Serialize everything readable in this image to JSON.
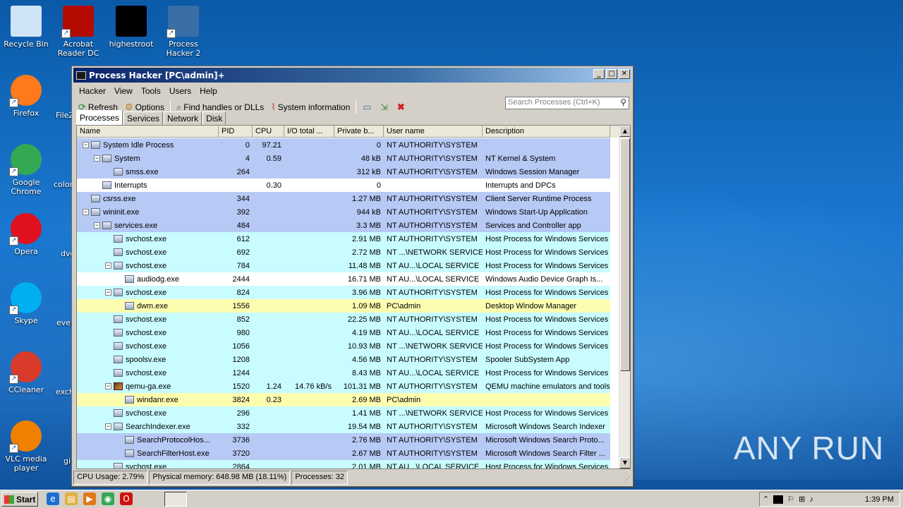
{
  "desktop": {
    "icons": [
      {
        "id": "recycle",
        "label": "Recycle Bin",
        "icon": "recycle-bin-icon",
        "color": "#cfe4f7"
      },
      {
        "id": "acrobat",
        "label": "Acrobat Reader DC",
        "icon": "acrobat-icon",
        "color": "#b30b00"
      },
      {
        "id": "highestroot",
        "label": "highestroot",
        "icon": "black-file-icon",
        "color": "#000000"
      },
      {
        "id": "processhacker",
        "label": "Process Hacker 2",
        "icon": "process-hacker-icon",
        "color": "#3a6ea5"
      },
      {
        "id": "firefox",
        "label": "Firefox",
        "icon": "firefox-icon",
        "color": "#ff7a1a"
      },
      {
        "id": "chrome",
        "label": "Google Chrome",
        "icon": "chrome-icon",
        "color": "#34a853"
      },
      {
        "id": "opera",
        "label": "Opera",
        "icon": "opera-icon",
        "color": "#e0101e"
      },
      {
        "id": "skype",
        "label": "Skype",
        "icon": "skype-icon",
        "color": "#00aff0"
      },
      {
        "id": "ccleaner",
        "label": "CCleaner",
        "icon": "ccleaner-icon",
        "color": "#d93b2b"
      },
      {
        "id": "vlc",
        "label": "VLC media player",
        "icon": "vlc-icon",
        "color": "#f08000"
      }
    ],
    "partial_labels": [
      "FileZ",
      "color",
      "dvd",
      "ever",
      "exch",
      "gi"
    ],
    "watermark": "ANY RUN"
  },
  "window": {
    "title": "Process Hacker [PC\\admin]+",
    "menu": [
      "Hacker",
      "View",
      "Tools",
      "Users",
      "Help"
    ],
    "toolbar": {
      "refresh": "Refresh",
      "options": "Options",
      "find_handles": "Find handles or DLLs",
      "system_info": "System information"
    },
    "search_placeholder": "Search Processes (Ctrl+K)",
    "tabs": [
      "Processes",
      "Services",
      "Network",
      "Disk"
    ],
    "columns": [
      "Name",
      "PID",
      "CPU",
      "I/O total ...",
      "Private b...",
      "User name",
      "Description"
    ],
    "rows": [
      {
        "name": "System Idle Process",
        "depth": 0,
        "toggle": "−",
        "pid": "0",
        "cpu": "97.21",
        "io": "",
        "priv": "0",
        "user": "NT AUTHORITY\\SYSTEM",
        "desc": "",
        "bg": "#b7c9f5"
      },
      {
        "name": "System",
        "depth": 1,
        "toggle": "−",
        "pid": "4",
        "cpu": "0.59",
        "io": "",
        "priv": "48 kB",
        "user": "NT AUTHORITY\\SYSTEM",
        "desc": "NT Kernel & System",
        "bg": "#b7c9f5"
      },
      {
        "name": "smss.exe",
        "depth": 2,
        "toggle": "",
        "pid": "264",
        "cpu": "",
        "io": "",
        "priv": "312 kB",
        "user": "NT AUTHORITY\\SYSTEM",
        "desc": "Windows Session Manager",
        "bg": "#b7c9f5"
      },
      {
        "name": "Interrupts",
        "depth": 1,
        "toggle": "",
        "pid": "",
        "cpu": "0.30",
        "io": "",
        "priv": "0",
        "user": "",
        "desc": "Interrupts and DPCs",
        "bg": "#ffffff"
      },
      {
        "name": "csrss.exe",
        "depth": 0,
        "toggle": "",
        "pid": "344",
        "cpu": "",
        "io": "",
        "priv": "1.27 MB",
        "user": "NT AUTHORITY\\SYSTEM",
        "desc": "Client Server Runtime Process",
        "bg": "#b7c9f5"
      },
      {
        "name": "wininit.exe",
        "depth": 0,
        "toggle": "−",
        "pid": "392",
        "cpu": "",
        "io": "",
        "priv": "944 kB",
        "user": "NT AUTHORITY\\SYSTEM",
        "desc": "Windows Start-Up Application",
        "bg": "#b7c9f5"
      },
      {
        "name": "services.exe",
        "depth": 1,
        "toggle": "−",
        "pid": "484",
        "cpu": "",
        "io": "",
        "priv": "3.3 MB",
        "user": "NT AUTHORITY\\SYSTEM",
        "desc": "Services and Controller app",
        "bg": "#b7c9f5"
      },
      {
        "name": "svchost.exe",
        "depth": 2,
        "toggle": "",
        "pid": "612",
        "cpu": "",
        "io": "",
        "priv": "2.91 MB",
        "user": "NT AUTHORITY\\SYSTEM",
        "desc": "Host Process for Windows Services",
        "bg": "#c8fcff"
      },
      {
        "name": "svchost.exe",
        "depth": 2,
        "toggle": "",
        "pid": "692",
        "cpu": "",
        "io": "",
        "priv": "2.72 MB",
        "user": "NT ...\\NETWORK SERVICE",
        "desc": "Host Process for Windows Services",
        "bg": "#c8fcff"
      },
      {
        "name": "svchost.exe",
        "depth": 2,
        "toggle": "−",
        "pid": "784",
        "cpu": "",
        "io": "",
        "priv": "11.48 MB",
        "user": "NT AU...\\LOCAL SERVICE",
        "desc": "Host Process for Windows Services",
        "bg": "#c8fcff"
      },
      {
        "name": "audiodg.exe",
        "depth": 3,
        "toggle": "",
        "pid": "2444",
        "cpu": "",
        "io": "",
        "priv": "16.71 MB",
        "user": "NT AU...\\LOCAL SERVICE",
        "desc": "Windows Audio Device Graph Is...",
        "bg": "#ffffff"
      },
      {
        "name": "svchost.exe",
        "depth": 2,
        "toggle": "−",
        "pid": "824",
        "cpu": "",
        "io": "",
        "priv": "3.96 MB",
        "user": "NT AUTHORITY\\SYSTEM",
        "desc": "Host Process for Windows Services",
        "bg": "#c8fcff"
      },
      {
        "name": "dwm.exe",
        "depth": 3,
        "toggle": "",
        "pid": "1556",
        "cpu": "",
        "io": "",
        "priv": "1.09 MB",
        "user": "PC\\admin",
        "desc": "Desktop Window Manager",
        "bg": "#fdfdb0"
      },
      {
        "name": "svchost.exe",
        "depth": 2,
        "toggle": "",
        "pid": "852",
        "cpu": "",
        "io": "",
        "priv": "22.25 MB",
        "user": "NT AUTHORITY\\SYSTEM",
        "desc": "Host Process for Windows Services",
        "bg": "#c8fcff"
      },
      {
        "name": "svchost.exe",
        "depth": 2,
        "toggle": "",
        "pid": "980",
        "cpu": "",
        "io": "",
        "priv": "4.19 MB",
        "user": "NT AU...\\LOCAL SERVICE",
        "desc": "Host Process for Windows Services",
        "bg": "#c8fcff"
      },
      {
        "name": "svchost.exe",
        "depth": 2,
        "toggle": "",
        "pid": "1056",
        "cpu": "",
        "io": "",
        "priv": "10.93 MB",
        "user": "NT ...\\NETWORK SERVICE",
        "desc": "Host Process for Windows Services",
        "bg": "#c8fcff"
      },
      {
        "name": "spoolsv.exe",
        "depth": 2,
        "toggle": "",
        "pid": "1208",
        "cpu": "",
        "io": "",
        "priv": "4.56 MB",
        "user": "NT AUTHORITY\\SYSTEM",
        "desc": "Spooler SubSystem App",
        "bg": "#c8fcff"
      },
      {
        "name": "svchost.exe",
        "depth": 2,
        "toggle": "",
        "pid": "1244",
        "cpu": "",
        "io": "",
        "priv": "8.43 MB",
        "user": "NT AU...\\LOCAL SERVICE",
        "desc": "Host Process for Windows Services",
        "bg": "#c8fcff"
      },
      {
        "name": "qemu-ga.exe",
        "depth": 2,
        "toggle": "−",
        "pid": "1520",
        "cpu": "1.24",
        "io": "14.76 kB/s",
        "priv": "101.31 MB",
        "user": "NT AUTHORITY\\SYSTEM",
        "desc": "QEMU machine emulators and tools",
        "bg": "#c8fcff",
        "qemu": true
      },
      {
        "name": "windanr.exe",
        "depth": 3,
        "toggle": "",
        "pid": "3824",
        "cpu": "0.23",
        "io": "",
        "priv": "2.69 MB",
        "user": "PC\\admin",
        "desc": "",
        "bg": "#fdfdb0"
      },
      {
        "name": "svchost.exe",
        "depth": 2,
        "toggle": "",
        "pid": "296",
        "cpu": "",
        "io": "",
        "priv": "1.41 MB",
        "user": "NT ...\\NETWORK SERVICE",
        "desc": "Host Process for Windows Services",
        "bg": "#c8fcff"
      },
      {
        "name": "SearchIndexer.exe",
        "depth": 2,
        "toggle": "−",
        "pid": "332",
        "cpu": "",
        "io": "",
        "priv": "19.54 MB",
        "user": "NT AUTHORITY\\SYSTEM",
        "desc": "Microsoft Windows Search Indexer",
        "bg": "#c8fcff"
      },
      {
        "name": "SearchProtocolHos...",
        "depth": 3,
        "toggle": "",
        "pid": "3736",
        "cpu": "",
        "io": "",
        "priv": "2.76 MB",
        "user": "NT AUTHORITY\\SYSTEM",
        "desc": "Microsoft Windows Search Proto...",
        "bg": "#b7c9f5"
      },
      {
        "name": "SearchFilterHost.exe",
        "depth": 3,
        "toggle": "",
        "pid": "3720",
        "cpu": "",
        "io": "",
        "priv": "2.67 MB",
        "user": "NT AUTHORITY\\SYSTEM",
        "desc": "Microsoft Windows Search Filter ...",
        "bg": "#b7c9f5"
      },
      {
        "name": "svchost.exe",
        "depth": 2,
        "toggle": "",
        "pid": "2864",
        "cpu": "",
        "io": "",
        "priv": "2.01 MB",
        "user": "NT AU...\\LOCAL SERVICE",
        "desc": "Host Process for Windows Services",
        "bg": "#c8fcff"
      }
    ],
    "status": {
      "cpu": "CPU Usage: 2.79%",
      "memory": "Physical memory: 648.98 MB (18.11%)",
      "processes": "Processes: 32"
    }
  },
  "taskbar": {
    "start": "Start",
    "clock": "1:39 PM"
  }
}
